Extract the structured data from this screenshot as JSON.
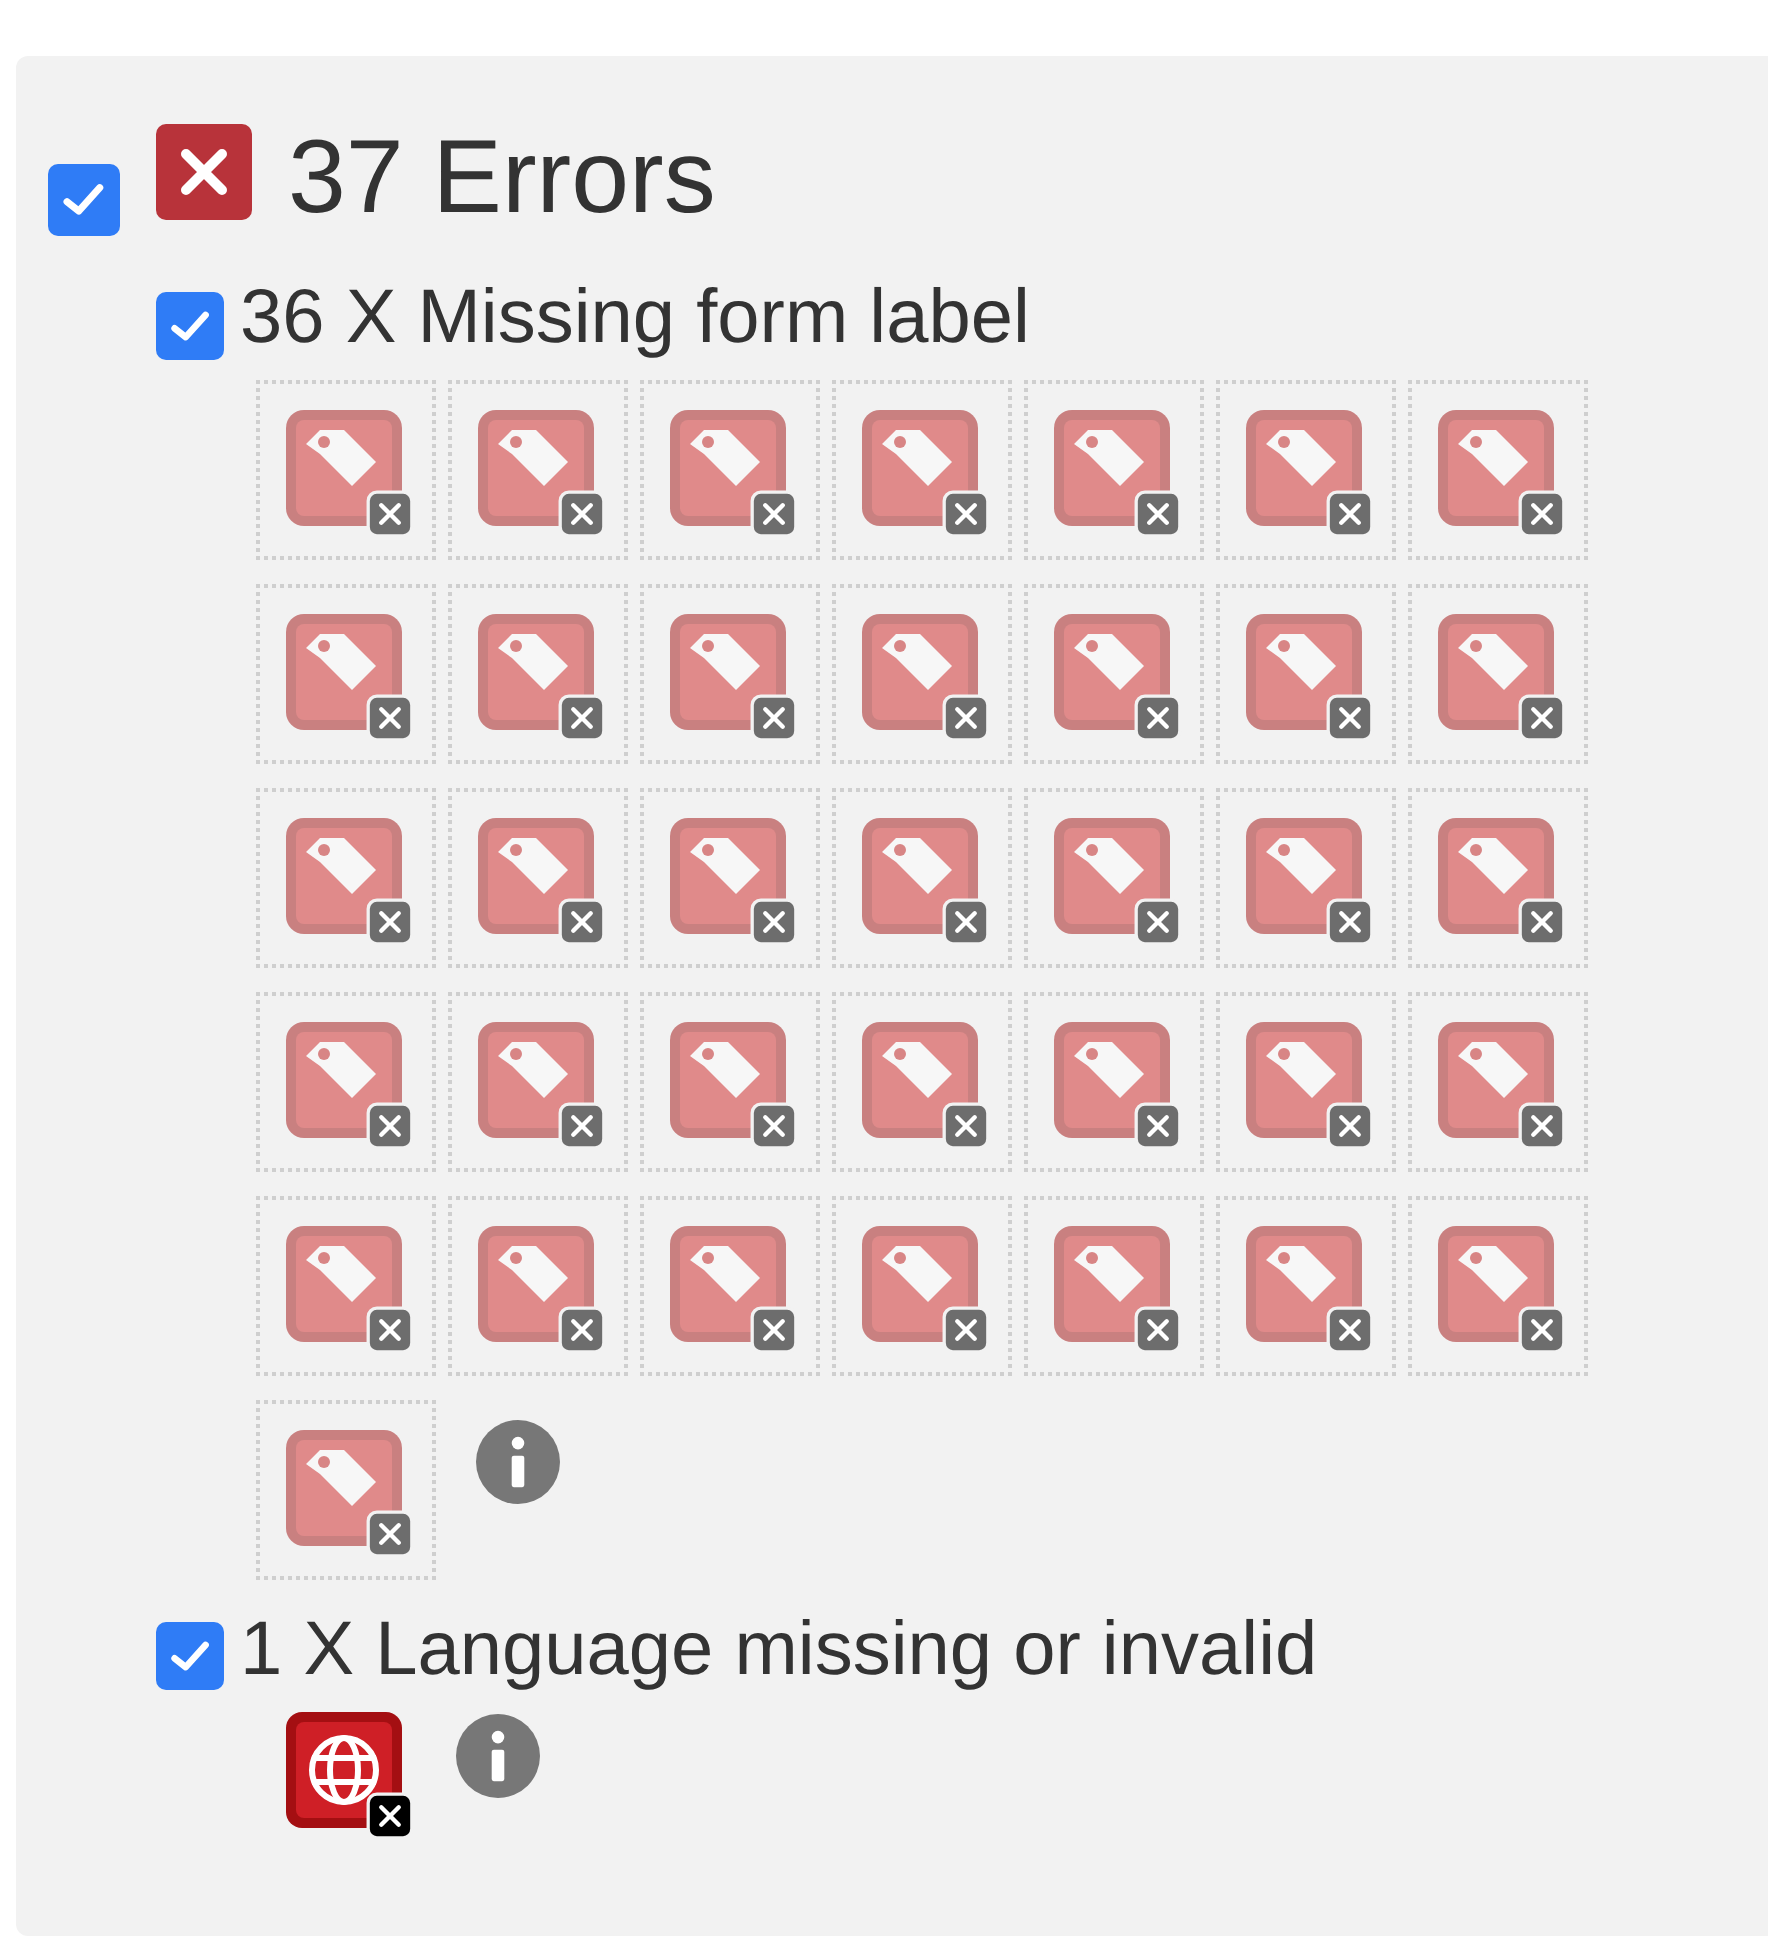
{
  "summary": {
    "checked": true,
    "title": "37 Errors"
  },
  "groups": [
    {
      "checked": true,
      "label": "36 X Missing form label",
      "icons": [
        {
          "kind": "tag"
        },
        {
          "kind": "tag"
        },
        {
          "kind": "tag"
        },
        {
          "kind": "tag"
        },
        {
          "kind": "tag"
        },
        {
          "kind": "tag"
        },
        {
          "kind": "tag"
        },
        {
          "kind": "tag"
        },
        {
          "kind": "tag"
        },
        {
          "kind": "tag"
        },
        {
          "kind": "tag"
        },
        {
          "kind": "tag"
        },
        {
          "kind": "tag"
        },
        {
          "kind": "tag"
        },
        {
          "kind": "tag"
        },
        {
          "kind": "tag"
        },
        {
          "kind": "tag"
        },
        {
          "kind": "tag"
        },
        {
          "kind": "tag"
        },
        {
          "kind": "tag"
        },
        {
          "kind": "tag"
        },
        {
          "kind": "tag"
        },
        {
          "kind": "tag"
        },
        {
          "kind": "tag"
        },
        {
          "kind": "tag"
        },
        {
          "kind": "tag"
        },
        {
          "kind": "tag"
        },
        {
          "kind": "tag"
        },
        {
          "kind": "tag"
        },
        {
          "kind": "tag"
        },
        {
          "kind": "tag"
        },
        {
          "kind": "tag"
        },
        {
          "kind": "tag"
        },
        {
          "kind": "tag"
        },
        {
          "kind": "tag"
        },
        {
          "kind": "tag"
        }
      ]
    },
    {
      "checked": true,
      "label": "1 X Language missing or invalid",
      "icons": [
        {
          "kind": "globe"
        }
      ]
    }
  ]
}
